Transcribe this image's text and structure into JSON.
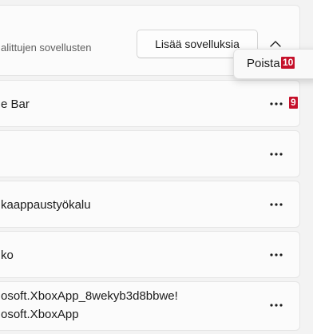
{
  "header": {
    "description": "alittujen sovellusten",
    "add_apps_label": "Lisää sovelluksia"
  },
  "context_menu": {
    "remove_label": "Poista",
    "remove_badge": "10"
  },
  "apps": [
    {
      "line1": "e Bar",
      "line2": "",
      "badge": "9"
    },
    {
      "line1": "",
      "line2": "",
      "badge": ""
    },
    {
      "line1": "kaappaustyökalu",
      "line2": "",
      "badge": ""
    },
    {
      "line1": "ko",
      "line2": "",
      "badge": ""
    },
    {
      "line1": "osoft.XboxApp_8wekyb3d8bbwe!",
      "line2": "osoft.XboxApp",
      "badge": ""
    }
  ],
  "icons": {
    "chevron": "chevron-up-icon",
    "more": "more-horizontal-icon"
  },
  "colors": {
    "badge_bg": "#c5102a",
    "card_bg": "#fbfbfb",
    "page_bg": "#f3f3f3"
  }
}
